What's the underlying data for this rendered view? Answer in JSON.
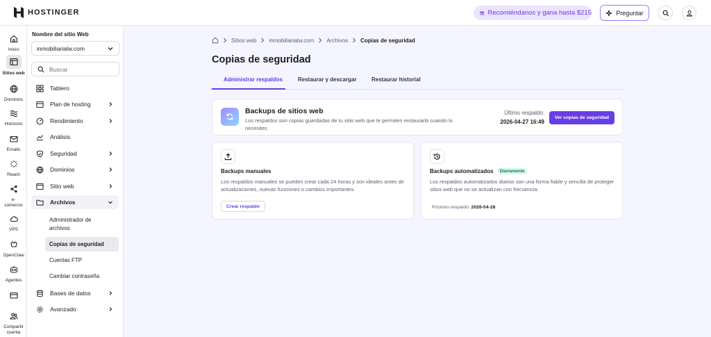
{
  "brand": {
    "name": "HOSTINGER"
  },
  "topbar": {
    "referral": "Recomiéndanos y gana hasta $215",
    "ask": "Preguntar"
  },
  "rail": {
    "items": [
      {
        "label": "Inicio",
        "icon": "home-icon"
      },
      {
        "label": "Sitios web",
        "icon": "websites-icon"
      },
      {
        "label": "Dominios",
        "icon": "globe-icon"
      },
      {
        "label": "Horizons",
        "icon": "horizons-icon"
      },
      {
        "label": "Emails",
        "icon": "mail-icon"
      },
      {
        "label": "Reach",
        "icon": "reach-icon"
      },
      {
        "label": "e-",
        "label2": "comercio",
        "icon": "share-icon"
      },
      {
        "label": "VPS",
        "icon": "cloud-icon"
      },
      {
        "label": "OpenClaw",
        "icon": "openclaw-icon"
      },
      {
        "label": "Agentes",
        "icon": "agent-icon"
      },
      {
        "label": "",
        "icon": "billing-icon"
      },
      {
        "label": "Compartir",
        "label2": "cuenta",
        "icon": "users-icon"
      }
    ]
  },
  "sidebar": {
    "site_label": "Nombre del sitio Web",
    "site_value": "inmobiliarialw.com",
    "search_placeholder": "Buscar",
    "items": [
      {
        "label": "Tablero"
      },
      {
        "label": "Plan de hosting"
      },
      {
        "label": "Rendimiento"
      },
      {
        "label": "Análisis"
      },
      {
        "label": "Seguridad"
      },
      {
        "label": "Dominios"
      },
      {
        "label": "Sitio web"
      },
      {
        "label": "Archivos"
      },
      {
        "label": "Bases de datos"
      },
      {
        "label": "Avanzado"
      }
    ],
    "sub_items": [
      {
        "label": "Administrador de archivos"
      },
      {
        "label": "Copias de seguridad"
      },
      {
        "label": "Cuentas FTP"
      },
      {
        "label": "Cambiar contraseña"
      }
    ]
  },
  "breadcrumb": {
    "items": [
      "Sitios web",
      "inmobiliarialw.com",
      "Archivos"
    ],
    "current": "Copias de seguridad"
  },
  "page": {
    "title": "Copias de seguridad",
    "tabs": [
      "Administrar respaldos",
      "Restaurar y descargar",
      "Restaurar historial"
    ]
  },
  "hero": {
    "title": "Backups de sitios web",
    "description": "Los respaldos son copias guardadas de tu sitio web que te permiten restaurarlo cuando lo necesites.",
    "last_label": "Último respaldo:",
    "last_value": "2026-04-27 16:49",
    "button": "Ver copias de seguridad"
  },
  "manual": {
    "title": "Backups manuales",
    "description": "Los respaldos manuales se pueden crear cada 24 horas y son ideales antes de actualizaciones, nuevas funciones o cambios importantes.",
    "button": "Crear respaldo"
  },
  "auto": {
    "title": "Backups automatizados",
    "badge": "Diariamente",
    "description": "Los respaldos automatizados diarios son una forma fiable y sencilla de proteger sitios web que no se actualizan con frecuencia.",
    "next_label": "Próximo respaldo:",
    "next_value": "2026-04-28"
  },
  "colors": {
    "accent": "#673de6",
    "badge_green": "#008361",
    "background": "#f4f5ff"
  }
}
